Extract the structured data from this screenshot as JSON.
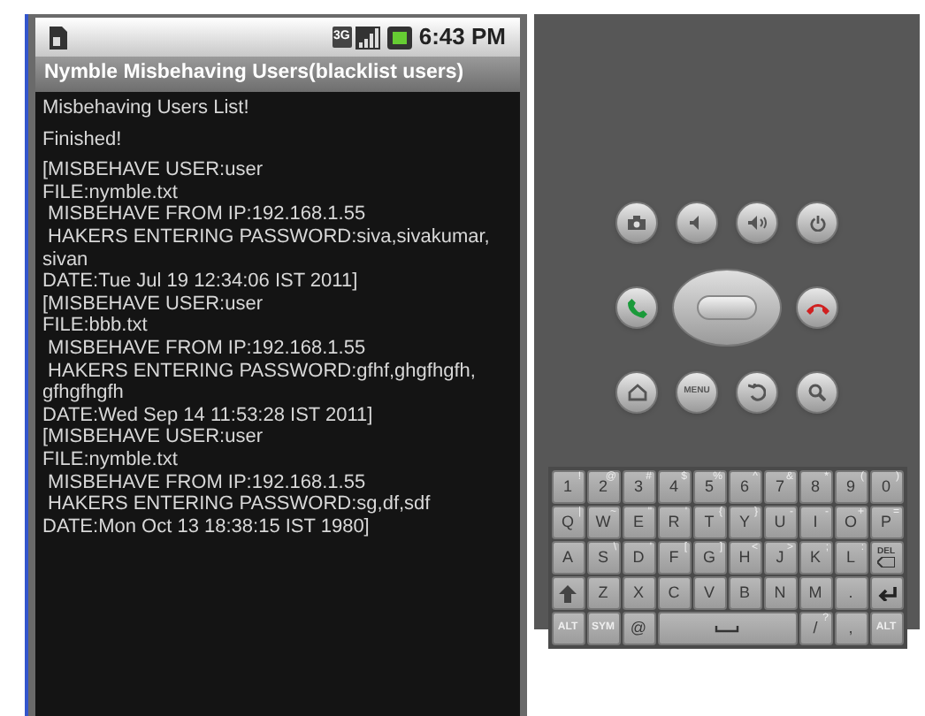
{
  "status_bar": {
    "network": "3G",
    "time": "6:43 PM"
  },
  "title_bar": {
    "title": "Nymble Misbehaving Users(blacklist users)"
  },
  "content": {
    "lines": [
      "Misbehaving Users List!",
      "Finished!",
      "[MISBEHAVE USER:user",
      "FILE:nymble.txt",
      " MISBEHAVE FROM IP:192.168.1.55",
      " HAKERS ENTERING PASSWORD:siva,sivakumar,",
      "sivan",
      "DATE:Tue Jul 19 12:34:06 IST 2011]",
      "[MISBEHAVE USER:user",
      "FILE:bbb.txt",
      " MISBEHAVE FROM IP:192.168.1.55",
      " HAKERS ENTERING PASSWORD:gfhf,ghgfhgfh,",
      "gfhgfhgfh",
      "DATE:Wed Sep 14 11:53:28 IST 2011]",
      "[MISBEHAVE USER:user",
      "FILE:nymble.txt",
      " MISBEHAVE FROM IP:192.168.1.55",
      " HAKERS ENTERING PASSWORD:sg,df,sdf",
      "DATE:Mon Oct 13 18:38:15 IST 1980]"
    ]
  },
  "controls": {
    "menu_label": "MENU"
  },
  "keyboard": {
    "rows": [
      [
        {
          "kind": "char",
          "main": "1",
          "alt": "!"
        },
        {
          "kind": "char",
          "main": "2",
          "alt": "@"
        },
        {
          "kind": "char",
          "main": "3",
          "alt": "#"
        },
        {
          "kind": "char",
          "main": "4",
          "alt": "$"
        },
        {
          "kind": "char",
          "main": "5",
          "alt": "%"
        },
        {
          "kind": "char",
          "main": "6",
          "alt": "^"
        },
        {
          "kind": "char",
          "main": "7",
          "alt": "&"
        },
        {
          "kind": "char",
          "main": "8",
          "alt": "*"
        },
        {
          "kind": "char",
          "main": "9",
          "alt": "("
        },
        {
          "kind": "char",
          "main": "0",
          "alt": ")"
        }
      ],
      [
        {
          "kind": "char",
          "main": "Q",
          "alt": "|"
        },
        {
          "kind": "char",
          "main": "W",
          "alt": "~"
        },
        {
          "kind": "char",
          "main": "E",
          "alt": "\""
        },
        {
          "kind": "char",
          "main": "R",
          "alt": "'"
        },
        {
          "kind": "char",
          "main": "T",
          "alt": "{"
        },
        {
          "kind": "char",
          "main": "Y",
          "alt": "}"
        },
        {
          "kind": "char",
          "main": "U",
          "alt": "-"
        },
        {
          "kind": "char",
          "main": "I",
          "alt": "-"
        },
        {
          "kind": "char",
          "main": "O",
          "alt": "+"
        },
        {
          "kind": "char",
          "main": "P",
          "alt": "="
        }
      ],
      [
        {
          "kind": "char",
          "main": "A"
        },
        {
          "kind": "char",
          "main": "S",
          "alt": "\\"
        },
        {
          "kind": "char",
          "main": "D",
          "alt": "'"
        },
        {
          "kind": "char",
          "main": "F",
          "alt": "["
        },
        {
          "kind": "char",
          "main": "G",
          "alt": "]"
        },
        {
          "kind": "char",
          "main": "H",
          "alt": "<"
        },
        {
          "kind": "char",
          "main": "J",
          "alt": ">"
        },
        {
          "kind": "char",
          "main": "K",
          "alt": ";"
        },
        {
          "kind": "char",
          "main": "L",
          "alt": ":"
        },
        {
          "kind": "del",
          "main": "DEL"
        }
      ],
      [
        {
          "kind": "shift"
        },
        {
          "kind": "char",
          "main": "Z"
        },
        {
          "kind": "char",
          "main": "X"
        },
        {
          "kind": "char",
          "main": "C"
        },
        {
          "kind": "char",
          "main": "V"
        },
        {
          "kind": "char",
          "main": "B"
        },
        {
          "kind": "char",
          "main": "N"
        },
        {
          "kind": "char",
          "main": "M"
        },
        {
          "kind": "char",
          "main": "."
        },
        {
          "kind": "enter"
        }
      ]
    ],
    "bottom_row": [
      {
        "kind": "mod",
        "main": "ALT"
      },
      {
        "kind": "mod",
        "main": "SYM"
      },
      {
        "kind": "char",
        "main": "@"
      },
      {
        "kind": "space"
      },
      {
        "kind": "char",
        "main": "/",
        "alt": "?"
      },
      {
        "kind": "char",
        "main": ","
      },
      {
        "kind": "mod",
        "main": "ALT"
      }
    ]
  }
}
